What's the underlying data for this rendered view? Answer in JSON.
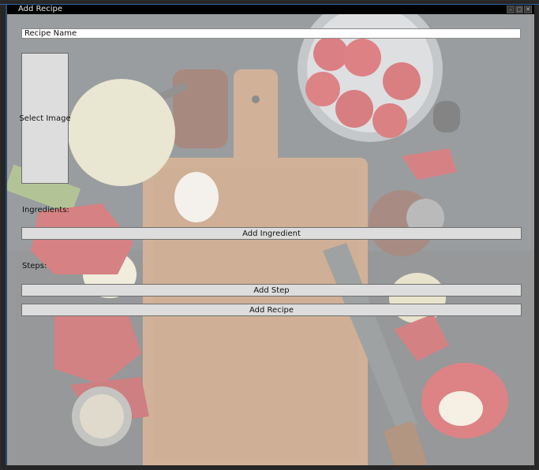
{
  "window": {
    "title": "Add Recipe",
    "controls": [
      "minimize-icon",
      "maximize-icon",
      "close-icon"
    ]
  },
  "form": {
    "recipe_name_value": "Recipe Name",
    "select_image_label": "Select Image",
    "ingredients_label": "Ingredients:",
    "add_ingredient_label": "Add Ingredient",
    "steps_label": "Steps:",
    "add_step_label": "Add Step",
    "add_recipe_label": "Add Recipe"
  },
  "colors": {
    "title_bar": "#000000",
    "button_fill": "#dddddd",
    "accent_edge": "#3c7bd6"
  }
}
